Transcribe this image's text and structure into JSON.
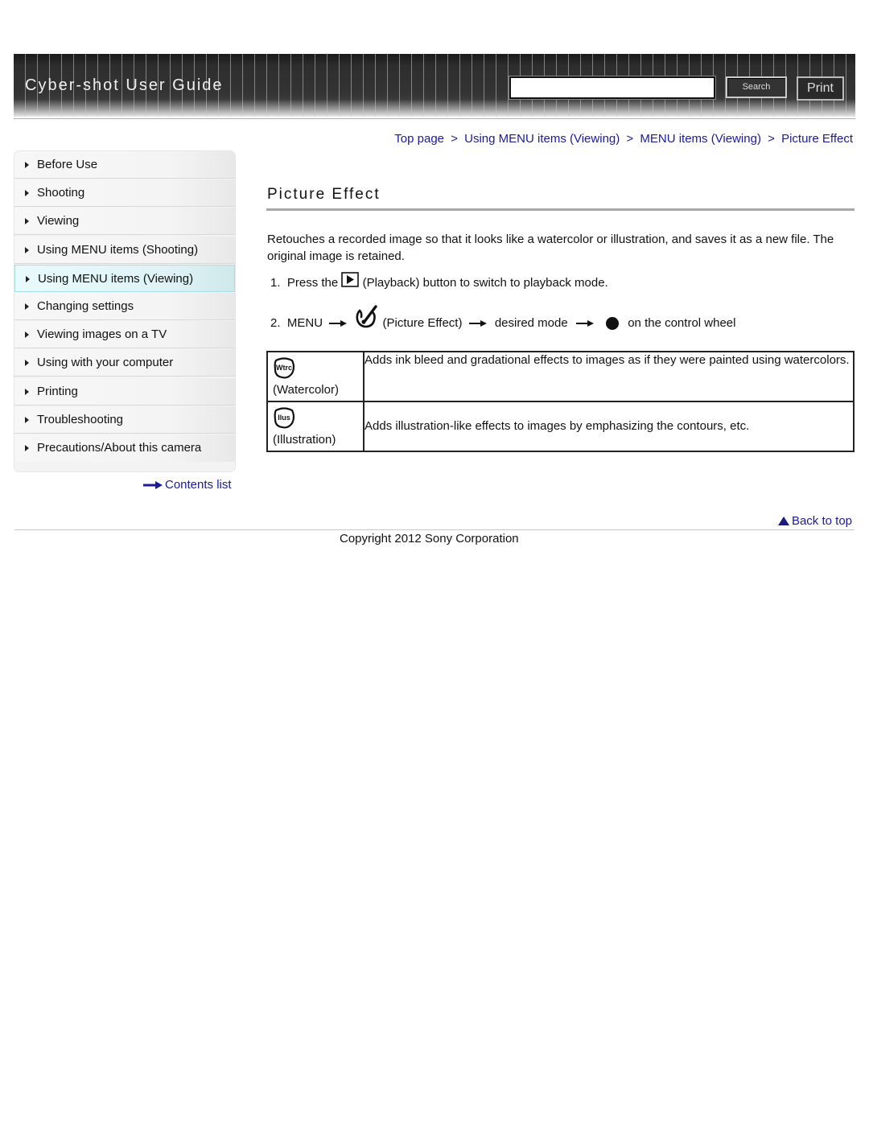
{
  "header": {
    "title": "Cyber-shot User Guide",
    "search_placeholder": "",
    "search_value": "",
    "search_button": "Search",
    "print_button": "Print"
  },
  "breadcrumb": [
    {
      "label": "Top page"
    },
    {
      "label": "Using MENU items (Viewing)"
    },
    {
      "label": "MENU items (Viewing)"
    },
    {
      "label": "Picture Effect"
    }
  ],
  "breadcrumb_separator": ">",
  "sidebar": {
    "items": [
      {
        "label": "Before Use",
        "active": false
      },
      {
        "label": "Shooting",
        "active": false
      },
      {
        "label": "Viewing",
        "active": false
      },
      {
        "label": "Using MENU items (Shooting)",
        "active": false
      },
      {
        "label": "Using MENU items (Viewing)",
        "active": true
      },
      {
        "label": "Changing settings",
        "active": false
      },
      {
        "label": "Viewing images on a TV",
        "active": false
      },
      {
        "label": "Using with your computer",
        "active": false
      },
      {
        "label": "Printing",
        "active": false
      },
      {
        "label": "Troubleshooting",
        "active": false
      },
      {
        "label": "Precautions/About this camera",
        "active": false
      }
    ],
    "contents_link": "Contents list"
  },
  "main": {
    "title": "Picture Effect",
    "intro": "Retouches a recorded image so that it looks like a watercolor or illustration, and saves it as a new file. The original image is retained.",
    "steps": [
      {
        "number": "1.",
        "before": "Press the",
        "icon": "playback-icon",
        "after": "(Playback) button to switch to playback mode."
      },
      {
        "number": "2.",
        "menu": "MENU",
        "icon": "picture-effect-icon",
        "effect_label": "(Picture Effect)",
        "mode_label": "desired mode",
        "button_icon": "center-button-icon",
        "end": "on the control wheel"
      }
    ],
    "modes": [
      {
        "icon": "watercolor-icon",
        "icon_text": "Wtrc",
        "name": "(Watercolor)",
        "description": "Adds ink bleed and gradational effects to images as if they were painted using watercolors."
      },
      {
        "icon": "illustration-icon",
        "icon_text": "Ilus",
        "name": "(Illustration)",
        "description": "Adds illustration-like effects to images by emphasizing the contours, etc."
      }
    ]
  },
  "footer": {
    "back_to_top": "Back to top",
    "copyright": "Copyright 2012 Sony Corporation"
  },
  "colors": {
    "link": "#1a1a9c",
    "active_nav_bg": "#dff3f6",
    "header_bg": "#333333"
  }
}
